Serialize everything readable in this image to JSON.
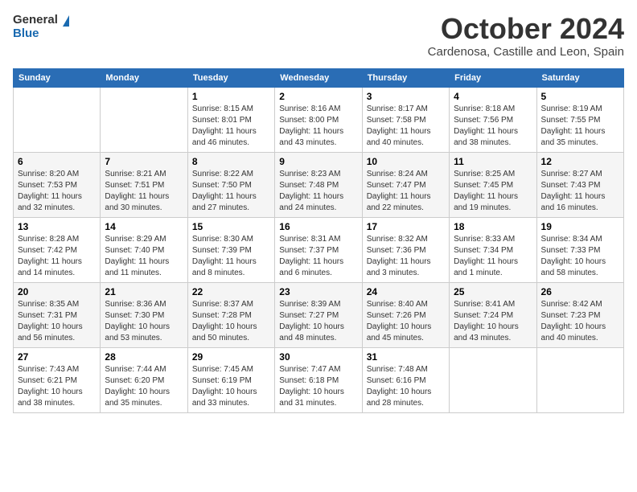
{
  "logo": {
    "general": "General",
    "blue": "Blue"
  },
  "header": {
    "month": "October 2024",
    "location": "Cardenosa, Castille and Leon, Spain"
  },
  "weekdays": [
    "Sunday",
    "Monday",
    "Tuesday",
    "Wednesday",
    "Thursday",
    "Friday",
    "Saturday"
  ],
  "weeks": [
    [
      {
        "day": null,
        "info": null
      },
      {
        "day": null,
        "info": null
      },
      {
        "day": "1",
        "info": "Sunrise: 8:15 AM\nSunset: 8:01 PM\nDaylight: 11 hours and 46 minutes."
      },
      {
        "day": "2",
        "info": "Sunrise: 8:16 AM\nSunset: 8:00 PM\nDaylight: 11 hours and 43 minutes."
      },
      {
        "day": "3",
        "info": "Sunrise: 8:17 AM\nSunset: 7:58 PM\nDaylight: 11 hours and 40 minutes."
      },
      {
        "day": "4",
        "info": "Sunrise: 8:18 AM\nSunset: 7:56 PM\nDaylight: 11 hours and 38 minutes."
      },
      {
        "day": "5",
        "info": "Sunrise: 8:19 AM\nSunset: 7:55 PM\nDaylight: 11 hours and 35 minutes."
      }
    ],
    [
      {
        "day": "6",
        "info": "Sunrise: 8:20 AM\nSunset: 7:53 PM\nDaylight: 11 hours and 32 minutes."
      },
      {
        "day": "7",
        "info": "Sunrise: 8:21 AM\nSunset: 7:51 PM\nDaylight: 11 hours and 30 minutes."
      },
      {
        "day": "8",
        "info": "Sunrise: 8:22 AM\nSunset: 7:50 PM\nDaylight: 11 hours and 27 minutes."
      },
      {
        "day": "9",
        "info": "Sunrise: 8:23 AM\nSunset: 7:48 PM\nDaylight: 11 hours and 24 minutes."
      },
      {
        "day": "10",
        "info": "Sunrise: 8:24 AM\nSunset: 7:47 PM\nDaylight: 11 hours and 22 minutes."
      },
      {
        "day": "11",
        "info": "Sunrise: 8:25 AM\nSunset: 7:45 PM\nDaylight: 11 hours and 19 minutes."
      },
      {
        "day": "12",
        "info": "Sunrise: 8:27 AM\nSunset: 7:43 PM\nDaylight: 11 hours and 16 minutes."
      }
    ],
    [
      {
        "day": "13",
        "info": "Sunrise: 8:28 AM\nSunset: 7:42 PM\nDaylight: 11 hours and 14 minutes."
      },
      {
        "day": "14",
        "info": "Sunrise: 8:29 AM\nSunset: 7:40 PM\nDaylight: 11 hours and 11 minutes."
      },
      {
        "day": "15",
        "info": "Sunrise: 8:30 AM\nSunset: 7:39 PM\nDaylight: 11 hours and 8 minutes."
      },
      {
        "day": "16",
        "info": "Sunrise: 8:31 AM\nSunset: 7:37 PM\nDaylight: 11 hours and 6 minutes."
      },
      {
        "day": "17",
        "info": "Sunrise: 8:32 AM\nSunset: 7:36 PM\nDaylight: 11 hours and 3 minutes."
      },
      {
        "day": "18",
        "info": "Sunrise: 8:33 AM\nSunset: 7:34 PM\nDaylight: 11 hours and 1 minute."
      },
      {
        "day": "19",
        "info": "Sunrise: 8:34 AM\nSunset: 7:33 PM\nDaylight: 10 hours and 58 minutes."
      }
    ],
    [
      {
        "day": "20",
        "info": "Sunrise: 8:35 AM\nSunset: 7:31 PM\nDaylight: 10 hours and 56 minutes."
      },
      {
        "day": "21",
        "info": "Sunrise: 8:36 AM\nSunset: 7:30 PM\nDaylight: 10 hours and 53 minutes."
      },
      {
        "day": "22",
        "info": "Sunrise: 8:37 AM\nSunset: 7:28 PM\nDaylight: 10 hours and 50 minutes."
      },
      {
        "day": "23",
        "info": "Sunrise: 8:39 AM\nSunset: 7:27 PM\nDaylight: 10 hours and 48 minutes."
      },
      {
        "day": "24",
        "info": "Sunrise: 8:40 AM\nSunset: 7:26 PM\nDaylight: 10 hours and 45 minutes."
      },
      {
        "day": "25",
        "info": "Sunrise: 8:41 AM\nSunset: 7:24 PM\nDaylight: 10 hours and 43 minutes."
      },
      {
        "day": "26",
        "info": "Sunrise: 8:42 AM\nSunset: 7:23 PM\nDaylight: 10 hours and 40 minutes."
      }
    ],
    [
      {
        "day": "27",
        "info": "Sunrise: 7:43 AM\nSunset: 6:21 PM\nDaylight: 10 hours and 38 minutes."
      },
      {
        "day": "28",
        "info": "Sunrise: 7:44 AM\nSunset: 6:20 PM\nDaylight: 10 hours and 35 minutes."
      },
      {
        "day": "29",
        "info": "Sunrise: 7:45 AM\nSunset: 6:19 PM\nDaylight: 10 hours and 33 minutes."
      },
      {
        "day": "30",
        "info": "Sunrise: 7:47 AM\nSunset: 6:18 PM\nDaylight: 10 hours and 31 minutes."
      },
      {
        "day": "31",
        "info": "Sunrise: 7:48 AM\nSunset: 6:16 PM\nDaylight: 10 hours and 28 minutes."
      },
      {
        "day": null,
        "info": null
      },
      {
        "day": null,
        "info": null
      }
    ]
  ]
}
